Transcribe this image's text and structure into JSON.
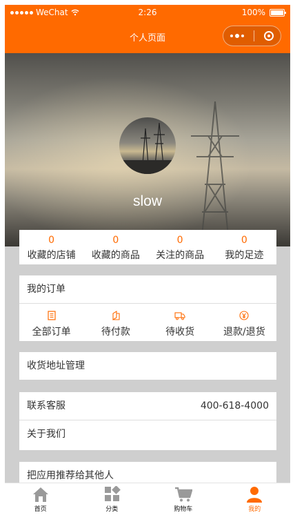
{
  "status_bar": {
    "carrier": "WeChat",
    "time": "2:26",
    "battery": "100%"
  },
  "nav": {
    "title": "个人页面"
  },
  "profile": {
    "username": "slow"
  },
  "stats": [
    {
      "count": "0",
      "label": "收藏的店铺"
    },
    {
      "count": "0",
      "label": "收藏的商品"
    },
    {
      "count": "0",
      "label": "关注的商品"
    },
    {
      "count": "0",
      "label": "我的足迹"
    }
  ],
  "orders": {
    "title": "我的订单",
    "items": [
      {
        "label": "全部订单",
        "icon": "document-icon"
      },
      {
        "label": "待付款",
        "icon": "payment-icon"
      },
      {
        "label": "待收货",
        "icon": "truck-icon"
      },
      {
        "label": "退款/退货",
        "icon": "refund-icon"
      }
    ]
  },
  "address": {
    "label": "收货地址管理"
  },
  "contact": {
    "label": "联系客服",
    "phone": "400-618-4000",
    "about": "关于我们"
  },
  "recommend": {
    "label": "把应用推荐给其他人"
  },
  "tabbar": [
    {
      "label": "首页",
      "icon": "home-icon"
    },
    {
      "label": "分类",
      "icon": "category-icon"
    },
    {
      "label": "购物车",
      "icon": "cart-icon"
    },
    {
      "label": "我的",
      "icon": "user-icon",
      "active": true
    }
  ],
  "colors": {
    "accent": "#ff6a00",
    "background": "#cfcfcf"
  }
}
